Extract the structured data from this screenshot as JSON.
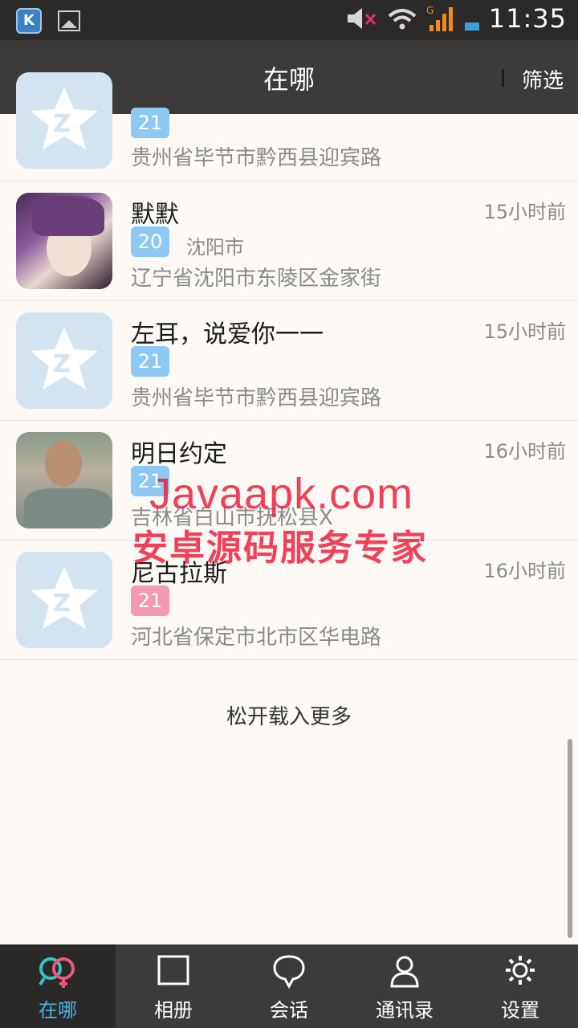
{
  "status_bar": {
    "time": "11:35"
  },
  "header": {
    "title": "在哪",
    "filter_label": "筛选"
  },
  "list": [
    {
      "name": "",
      "time": "",
      "age": "21",
      "gender": "male",
      "city": "",
      "address": "贵州省毕节市黔西县迎宾路",
      "avatar": "default-star-avatar"
    },
    {
      "name": "默默",
      "time": "15小时前",
      "age": "20",
      "gender": "male",
      "city": "沈阳市",
      "address": "辽宁省沈阳市东陵区金家街",
      "avatar": "anime-avatar"
    },
    {
      "name": "左耳，说爱你一一",
      "time": "15小时前",
      "age": "21",
      "gender": "male",
      "city": "",
      "address": "贵州省毕节市黔西县迎宾路",
      "avatar": "default-star-avatar"
    },
    {
      "name": "明日约定",
      "time": "16小时前",
      "age": "21",
      "gender": "male",
      "city": "",
      "address": "吉林省白山市抚松县X",
      "avatar": "photo-avatar"
    },
    {
      "name": "尼古拉斯",
      "time": "16小时前",
      "age": "21",
      "gender": "female",
      "city": "",
      "address": "河北省保定市北市区华电路",
      "avatar": "default-star-avatar"
    }
  ],
  "load_more": "松开载入更多",
  "watermark": {
    "line1": "Javaapk.com",
    "line2": "安卓源码服务专家"
  },
  "tabs": [
    {
      "label": "在哪",
      "icon": "gender-circles-icon",
      "active": true
    },
    {
      "label": "相册",
      "icon": "square-icon",
      "active": false
    },
    {
      "label": "会话",
      "icon": "chat-bubble-icon",
      "active": false
    },
    {
      "label": "通讯录",
      "icon": "person-icon",
      "active": false
    },
    {
      "label": "设置",
      "icon": "gear-icon",
      "active": false
    }
  ],
  "colors": {
    "accent": "#4ab5e2",
    "male_badge": "#8ec9f5",
    "female_badge": "#f29ab0",
    "bar": "#3c3b39"
  }
}
